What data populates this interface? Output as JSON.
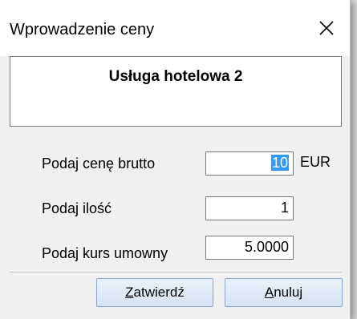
{
  "window": {
    "title": "Wprowadzenie ceny",
    "close_icon": "close-icon"
  },
  "item": {
    "name": "Usługa hotelowa 2"
  },
  "fields": {
    "price": {
      "label": "Podaj cenę brutto",
      "value": "10",
      "currency": "EUR"
    },
    "quantity": {
      "label": "Podaj ilość",
      "value": "1"
    },
    "rate": {
      "label": "Podaj kurs umowny",
      "value": "5.0000"
    }
  },
  "buttons": {
    "confirm": {
      "mnemonic": "Z",
      "rest": "atwierdź"
    },
    "cancel": {
      "mnemonic": "A",
      "rest": "nuluj"
    }
  },
  "colors": {
    "selection": "#3399ff",
    "button_border": "#8da5c8"
  }
}
